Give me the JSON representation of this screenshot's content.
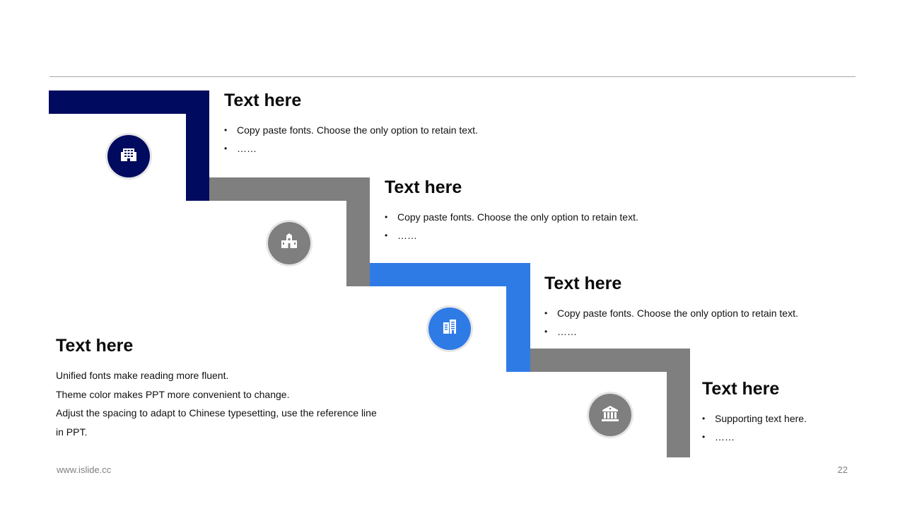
{
  "colors": {
    "navy": "#000a5e",
    "gray": "#7f7f7f",
    "blue": "#2f7be6",
    "divider": "#a6a6a6"
  },
  "steps": [
    {
      "title": "Text here",
      "bullets": [
        "Copy paste fonts. Choose the only option to retain text.",
        "……"
      ],
      "icon": "office-building-icon"
    },
    {
      "title": "Text here",
      "bullets": [
        "Copy paste fonts. Choose the only option to retain text.",
        "……"
      ],
      "icon": "city-buildings-icon"
    },
    {
      "title": "Text here",
      "bullets": [
        "Copy paste fonts. Choose the only option to retain text.",
        "……"
      ],
      "icon": "apartment-building-icon"
    },
    {
      "title": "Text here",
      "bullets": [
        "Supporting text here.",
        "……"
      ],
      "icon": "bank-icon"
    }
  ],
  "summary": {
    "title": "Text here",
    "lines": [
      "Unified fonts make reading more fluent.",
      "Theme color makes PPT more convenient to change.",
      "Adjust the spacing to adapt to Chinese typesetting, use the reference line",
      "in PPT."
    ]
  },
  "footer": {
    "website": "www.islide.cc",
    "page_number": "22"
  }
}
